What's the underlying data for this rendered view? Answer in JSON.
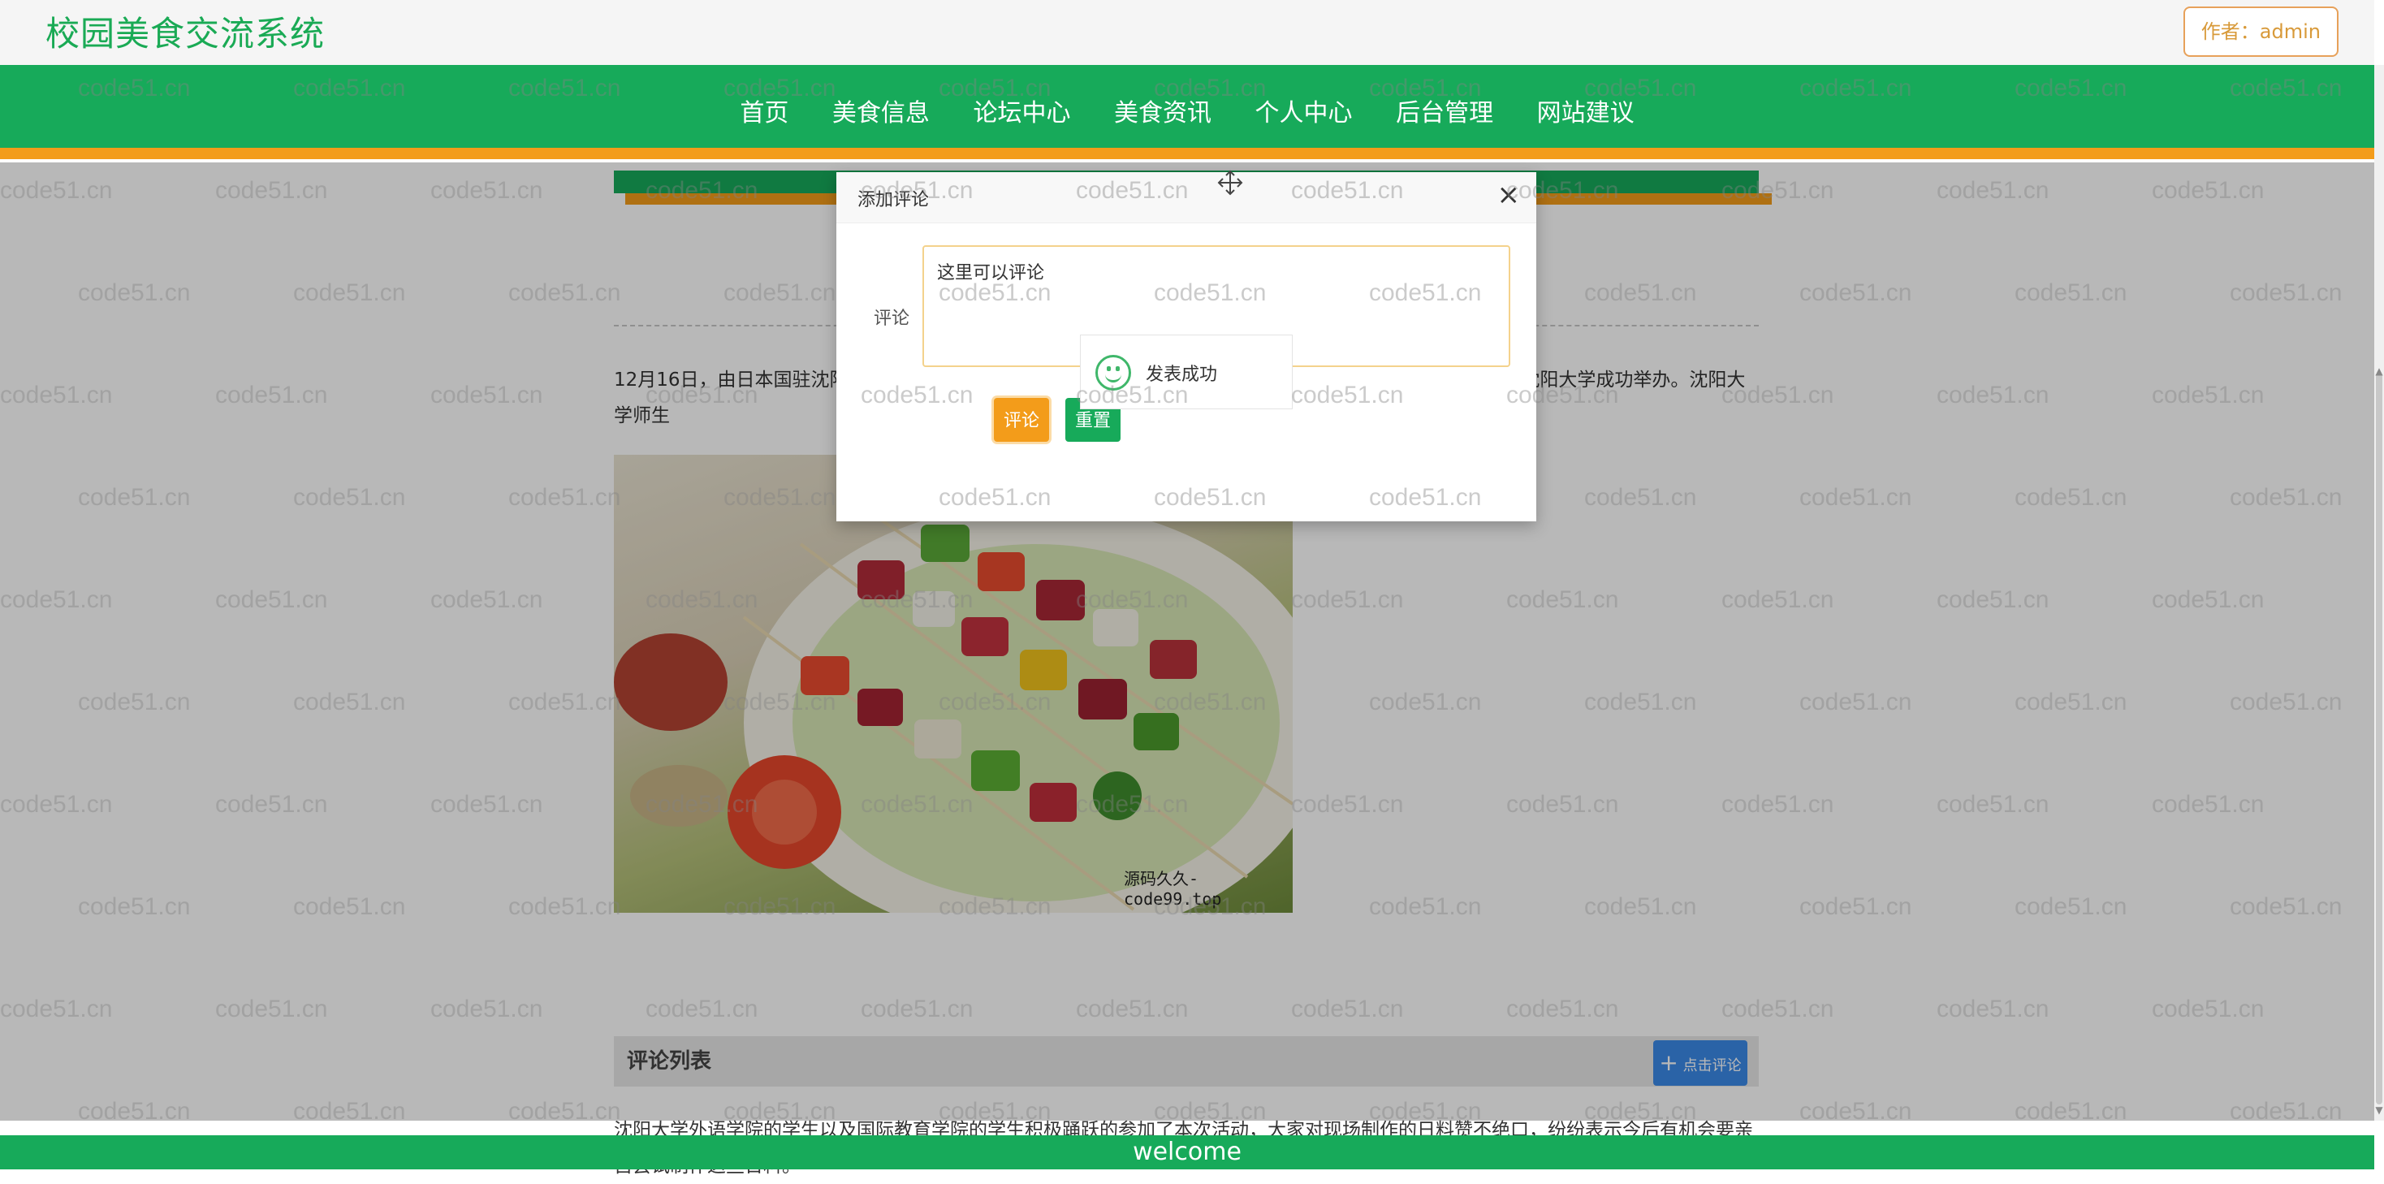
{
  "header": {
    "title": "校园美食交流系统",
    "author_badge": "作者：admin"
  },
  "nav": {
    "items": [
      "首页",
      "美食信息",
      "论坛中心",
      "美食资讯",
      "个人中心",
      "后台管理",
      "网站建议"
    ]
  },
  "article": {
    "paragraph1": "12月16日，由日本国驻沈阳总领事馆、沈阳大学外语学院与国际教育学院共同主办的“日本美食大讲堂”活动在沈阳大学成功举办。沈阳大学师生",
    "image_watermark": "源码久久-code99.top",
    "paragraph2": "沈阳大学外语学院的学生以及国际教育学院的学生积极踊跃的参加了本次活动，大家对现场制作的日料赞不绝口，纷纷表示今后有机会要亲自尝试制作这些日料。"
  },
  "comments": {
    "title": "评论列表",
    "add_button": "点击评论"
  },
  "footer": {
    "text": "welcome"
  },
  "modal": {
    "title": "添加评论",
    "close": "×",
    "field_label": "评论",
    "textarea_value": "这里可以评论",
    "submit_label": "评论",
    "reset_label": "重置"
  },
  "toast": {
    "message": "发表成功"
  },
  "watermark": {
    "text": "code51.cn"
  },
  "icons": {
    "close": "close-icon",
    "move": "move-icon",
    "success": "smiley-icon",
    "add": "plus-icon"
  },
  "colors": {
    "brand_green": "#17aa5a",
    "accent_orange": "#f39c1a",
    "title_green": "#1aaa55",
    "button_blue": "#3b89e8"
  }
}
